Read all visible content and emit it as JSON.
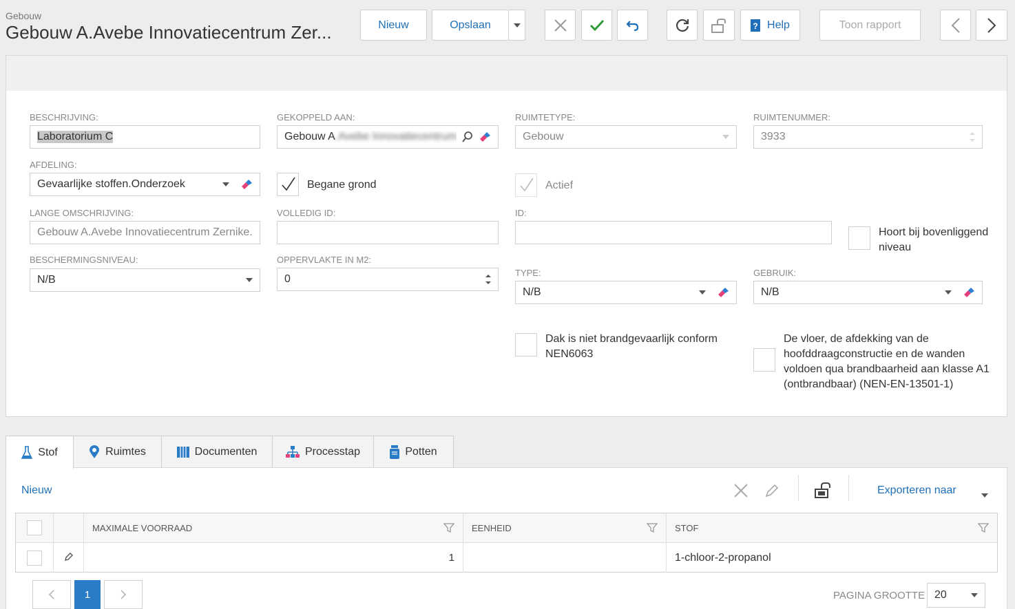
{
  "header": {
    "crumb": "Gebouw",
    "title": "Gebouw A.Avebe Innovatiecentrum Zer..."
  },
  "toolbar": {
    "new_label": "Nieuw",
    "save_label": "Opslaan",
    "help_label": "Help",
    "report_label": "Toon rapport"
  },
  "form": {
    "beschrijving": {
      "label": "BESCHRIJVING:",
      "value": "Laboratorium C"
    },
    "gekoppeld": {
      "label": "GEKOPPELD AAN:",
      "value_prefix": "Gebouw A",
      "value_blurred": ".Avebe Innovatiecentrum"
    },
    "ruimtetype": {
      "label": "RUIMTETYPE:",
      "value": "Gebouw"
    },
    "ruimtenummer": {
      "label": "RUIMTENUMMER:",
      "value": "3933"
    },
    "afdeling": {
      "label": "AFDELING:",
      "value": "Gevaarlijke stoffen.Onderzoek"
    },
    "begane_grond": {
      "label": "Begane grond",
      "checked": true
    },
    "actief": {
      "label": "Actief",
      "checked": true
    },
    "lange_omschrijving": {
      "label": "LANGE OMSCHRIJVING:",
      "value": "Gebouw A.Avebe Innovatiecentrum Zernike.V"
    },
    "volledig_id": {
      "label": "VOLLEDIG ID:",
      "value": ""
    },
    "id": {
      "label": "ID:",
      "value": ""
    },
    "hoort_bij": {
      "label": "Hoort bij bovenliggend niveau",
      "checked": false
    },
    "beschermingsniveau": {
      "label": "BESCHERMINGSNIVEAU:",
      "value": "N/B"
    },
    "oppervlakte": {
      "label": "OPPERVLAKTE IN M2:",
      "value": "0"
    },
    "type": {
      "label": "TYPE:",
      "value": "N/B"
    },
    "gebruik": {
      "label": "GEBRUIK:",
      "value": "N/B"
    },
    "dak": {
      "label": "Dak is niet brandgevaarlijk conform NEN6063",
      "checked": false
    },
    "vloer": {
      "label": "De vloer, de afdekking van de hoofddraagconstructie en de wanden voldoen qua brandbaarheid aan klasse A1 (ontbrandbaar) (NEN-EN-13501-1)",
      "checked": false
    }
  },
  "tabs": [
    {
      "label": "Stof",
      "icon": "flask-icon",
      "active": true
    },
    {
      "label": "Ruimtes",
      "icon": "map-pin-icon",
      "active": false
    },
    {
      "label": "Documenten",
      "icon": "documents-icon",
      "active": false
    },
    {
      "label": "Processtap",
      "icon": "process-icon",
      "active": false
    },
    {
      "label": "Potten",
      "icon": "jar-icon",
      "active": false
    }
  ],
  "grid": {
    "new_label": "Nieuw",
    "export_label": "Exporteren naar",
    "columns": [
      "MAXIMALE VOORRAAD",
      "EENHEID",
      "STOF"
    ],
    "rows": [
      {
        "maximale_voorraad": "1",
        "eenheid": "",
        "stof": "1-chloor-2-propanol"
      }
    ],
    "pager": {
      "current_page": "1",
      "page_size_label": "PAGINA GROOTTE",
      "page_size": "20"
    }
  },
  "colors": {
    "accent_blue": "#1f6fb8",
    "confirm_green": "#2e9a3a",
    "active_page": "#2a7cc7"
  }
}
